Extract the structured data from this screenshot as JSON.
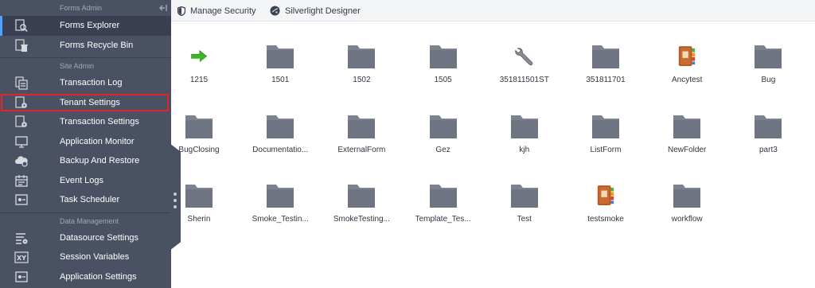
{
  "sidebar": {
    "sections": [
      {
        "title": "Forms Admin",
        "items": [
          {
            "label": "Forms Explorer",
            "icon": "forms-explorer-icon",
            "active": true
          },
          {
            "label": "Forms Recycle Bin",
            "icon": "recycle-bin-icon"
          }
        ]
      },
      {
        "title": "Site Admin",
        "items": [
          {
            "label": "Transaction Log",
            "icon": "transaction-log-icon"
          },
          {
            "label": "Tenant Settings",
            "icon": "tenant-settings-icon",
            "highlighted": true
          },
          {
            "label": "Transaction Settings",
            "icon": "transaction-settings-icon"
          },
          {
            "label": "Application Monitor",
            "icon": "monitor-icon"
          },
          {
            "label": "Backup And Restore",
            "icon": "cloud-backup-icon"
          },
          {
            "label": "Event Logs",
            "icon": "calendar-icon"
          },
          {
            "label": "Task Scheduler",
            "icon": "task-scheduler-icon"
          }
        ]
      },
      {
        "title": "Data Management",
        "items": [
          {
            "label": "Datasource Settings",
            "icon": "datasource-settings-icon"
          },
          {
            "label": "Session Variables",
            "icon": "xy-variables-icon"
          },
          {
            "label": "Application Settings",
            "icon": "application-settings-icon"
          }
        ]
      }
    ]
  },
  "toolbar": {
    "manage_security": "Manage Security",
    "silverlight_designer": "Silverlight Designer"
  },
  "items": [
    {
      "name": "1215",
      "type": "shortcut"
    },
    {
      "name": "1501",
      "type": "folder"
    },
    {
      "name": "1502",
      "type": "folder"
    },
    {
      "name": "1505",
      "type": "folder"
    },
    {
      "name": "351811501ST",
      "type": "tool"
    },
    {
      "name": "351811701",
      "type": "folder"
    },
    {
      "name": "Ancytest",
      "type": "book"
    },
    {
      "name": "Bug",
      "type": "folder"
    },
    {
      "name": "BugClosing",
      "type": "folder"
    },
    {
      "name": "Documentatio...",
      "type": "folder"
    },
    {
      "name": "ExternalForm",
      "type": "folder"
    },
    {
      "name": "Gez",
      "type": "folder"
    },
    {
      "name": "kjh",
      "type": "folder"
    },
    {
      "name": "ListForm",
      "type": "folder"
    },
    {
      "name": "NewFolder",
      "type": "folder"
    },
    {
      "name": "part3",
      "type": "folder"
    },
    {
      "name": "Sherin",
      "type": "folder"
    },
    {
      "name": "Smoke_Testin...",
      "type": "folder"
    },
    {
      "name": "SmokeTesting...",
      "type": "folder"
    },
    {
      "name": "Template_Tes...",
      "type": "folder"
    },
    {
      "name": "Test",
      "type": "folder"
    },
    {
      "name": "testsmoke",
      "type": "book"
    },
    {
      "name": "workflow",
      "type": "folder"
    }
  ],
  "colors": {
    "sidebar_bg": "#4a5163",
    "active_indicator": "#4da3ff",
    "highlight_border": "#e0262b",
    "folder": "#7d8290"
  }
}
